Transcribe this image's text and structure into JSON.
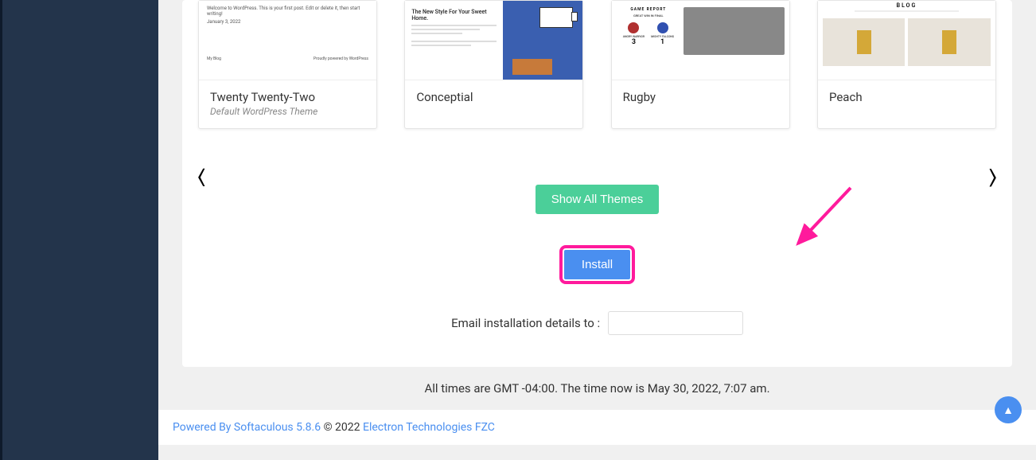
{
  "themes": [
    {
      "title": "Twenty Twenty-Two",
      "subtitle": "Default WordPress Theme"
    },
    {
      "title": "Conceptial",
      "subtitle": ""
    },
    {
      "title": "Rugby",
      "subtitle": ""
    },
    {
      "title": "Peach",
      "subtitle": ""
    }
  ],
  "thumb_text": {
    "t1_welcome": "Welcome to WordPress. This is your first post. Edit or delete it, then start writing!",
    "t1_date": "January 3, 2022",
    "t1_blog": "My Blog",
    "t1_powered": "Proudly powered by WordPress",
    "t2_headline": "The New Style For Your Sweet Home.",
    "t3_title": "GAME REPORT",
    "t3_sub": "GREAT WIN IN FINAL",
    "t3_team_a": "ANGRY WARRIOR",
    "t3_team_b": "MIGHTY FALCONS",
    "t3_score_a": "3",
    "t3_score_b": "1",
    "t4_title": "BLOG"
  },
  "buttons": {
    "show_all": "Show All Themes",
    "install": "Install"
  },
  "labels": {
    "email": "Email installation details to :"
  },
  "times_bar": "All times are GMT -04:00. The time now is May 30, 2022, 7:07 am.",
  "footer": {
    "powered": "Powered By Softaculous 5.8.6",
    "copy": " © 2022 ",
    "company": "Electron Technologies FZC"
  }
}
